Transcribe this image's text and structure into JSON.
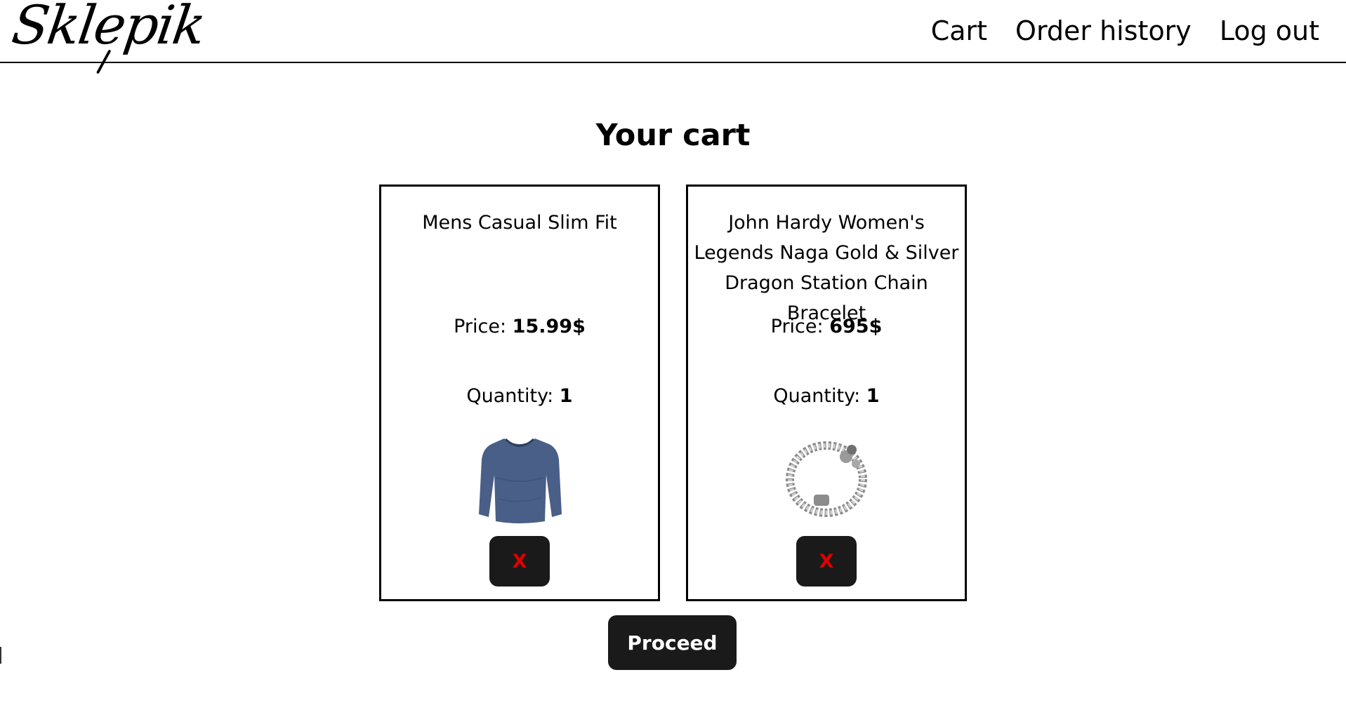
{
  "header": {
    "logo": "Sklepik",
    "nav": [
      "Cart",
      "Order history",
      "Log out"
    ]
  },
  "page": {
    "title": "Your cart",
    "proceed_label": "Proceed"
  },
  "cart": {
    "items": [
      {
        "name": "Mens Casual Slim Fit",
        "price_label": "Price:",
        "price": "15.99$",
        "quantity_label": "Quantity:",
        "quantity": "1",
        "image": "blue-long-sleeve-shirt",
        "remove_label": "X"
      },
      {
        "name": "John Hardy Women's Legends Naga Gold & Silver Dragon Station Chain Bracelet",
        "price_label": "Price:",
        "price": "695$",
        "quantity_label": "Quantity:",
        "quantity": "1",
        "image": "silver-dragon-bracelet",
        "remove_label": "X"
      }
    ]
  },
  "colors": {
    "button_bg": "#1a1a1a",
    "remove_text": "#e00000",
    "proceed_text": "#ffffff",
    "border": "#000000"
  }
}
